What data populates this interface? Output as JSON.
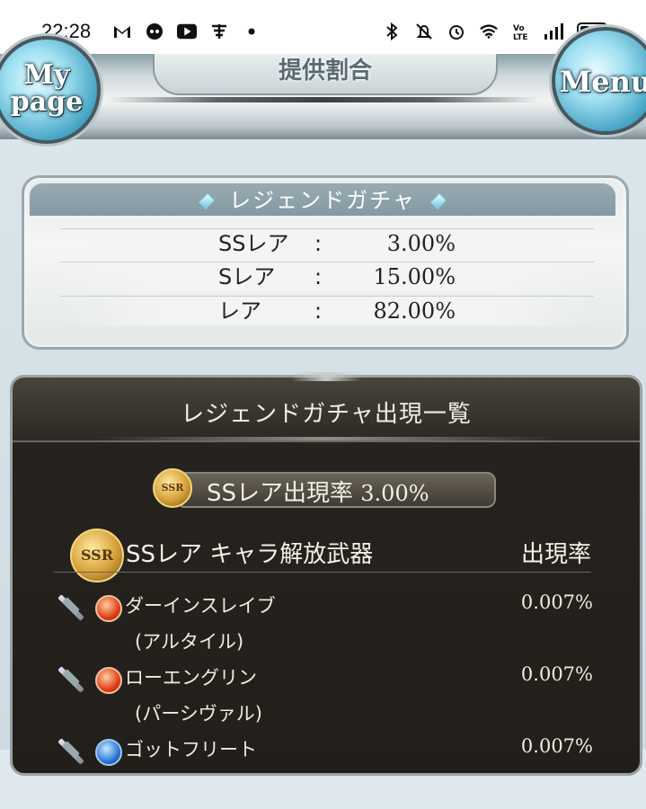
{
  "status_bar": {
    "time": "22:28",
    "left_icons": [
      "gmail-icon",
      "app-icon",
      "youtube-icon",
      "app2-icon",
      "dot-icon"
    ],
    "right_icons": [
      "bluetooth-icon",
      "vibrate-icon",
      "alarm-icon",
      "wifi-icon",
      "volte-icon",
      "signal-icon",
      "battery-icon"
    ]
  },
  "header": {
    "title": "提供割合",
    "mypage_line1": "My",
    "mypage_line2": "page",
    "menu_label": "Menu"
  },
  "rate_table": {
    "title": "レジェンドガチャ",
    "rows": [
      {
        "name": "SSレア",
        "colon": ":",
        "value": "3.00%"
      },
      {
        "name": "Sレア",
        "colon": ":",
        "value": "15.00%"
      },
      {
        "name": "レア",
        "colon": ":",
        "value": "82.00%"
      }
    ]
  },
  "list_panel": {
    "title": "レジェンドガチャ出現一覧",
    "ssr_rate_label": "SSレア出現率",
    "ssr_rate_value": "3.00%",
    "badge_text": "SSR",
    "category_title": "SSレア キャラ解放武器",
    "category_rate_header": "出現率",
    "items": [
      {
        "name": "ダーインスレイブ",
        "sub": "(アルタイル)",
        "rate": "0.007%",
        "element": "fire"
      },
      {
        "name": "ローエングリン",
        "sub": "(パーシヴァル)",
        "rate": "0.007%",
        "element": "fire"
      },
      {
        "name": "ゴットフリート",
        "sub": "",
        "rate": "0.007%",
        "element": "water"
      }
    ]
  }
}
